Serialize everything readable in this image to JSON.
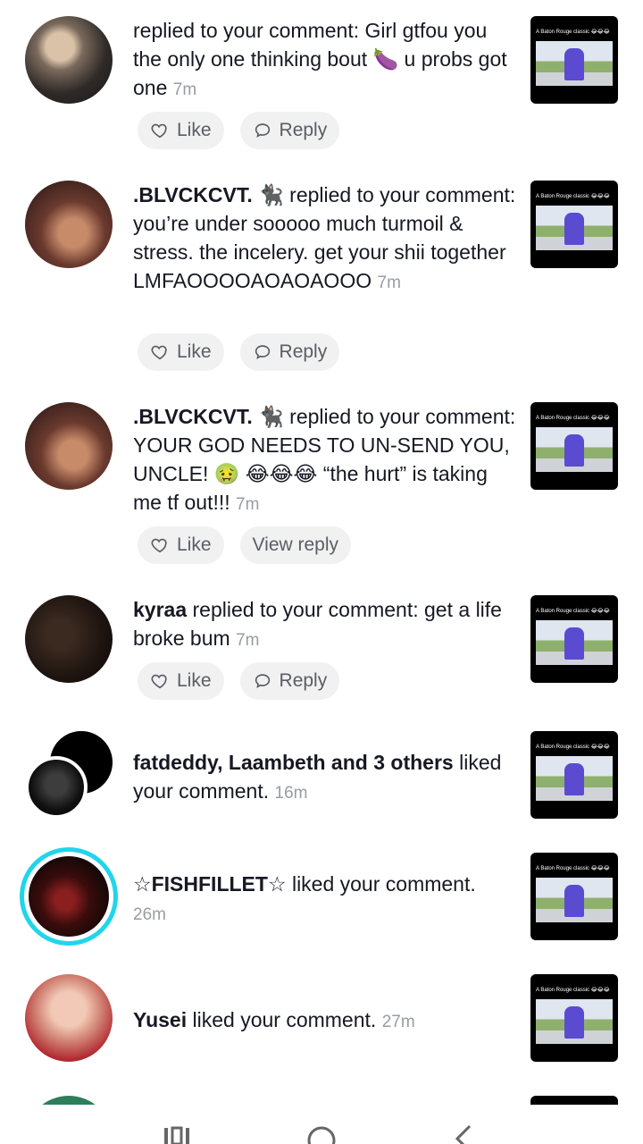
{
  "notifications": [
    {
      "text": " replied to your comment: Girl gtfou you the only one thinking bout 🍆 u probs got one",
      "time": "7m",
      "actions": [
        "Like",
        "Reply"
      ]
    },
    {
      "user": ".BLVCKCVT.",
      "text": " 🐈‍⬛ replied to your comment: you’re under sooooo much turmoil & stress. the incelery. get your shii together LMFAOOOOAOAOAOOO",
      "time": "7m",
      "actions": [
        "Like",
        "Reply"
      ]
    },
    {
      "user": ".BLVCKCVT.",
      "text": " 🐈‍⬛ replied to your comment: YOUR GOD NEEDS TO UN-SEND YOU, UNCLE! 🤢 😂😂😂 “the hurt” is taking me tf out!!!",
      "time": "7m",
      "actions": [
        "Like",
        "View reply"
      ]
    },
    {
      "user": "kyraa",
      "text": " replied to your comment: get a life broke bum",
      "time": "7m",
      "actions": [
        "Like",
        "Reply"
      ]
    },
    {
      "user": "fatdeddy, Laambeth and 3 others",
      "text": " liked your comment.",
      "time": "16m"
    },
    {
      "user": "☆FISHFILLET☆",
      "text": " liked your comment.",
      "time": "26m"
    },
    {
      "user": "Yusei",
      "text": " liked your comment.",
      "time": "27m"
    }
  ],
  "thumbnail_caption": "A Baton Rouge classic 😂😂😂",
  "icons": {
    "like": "heart-outline-icon",
    "reply": "speech-bubble-icon"
  },
  "colors": {
    "story_ring": "#20d5ec",
    "pill_bg": "#f1f1f2",
    "time": "#9a9ca3"
  }
}
